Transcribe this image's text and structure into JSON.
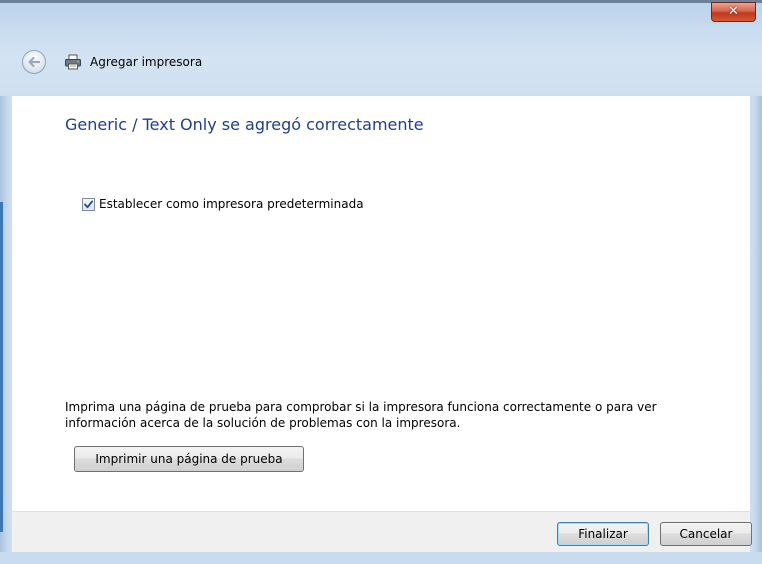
{
  "window": {
    "title": "Agregar impresora",
    "close_glyph": "✕"
  },
  "icons": {
    "back": "back-arrow-icon",
    "printer": "printer-icon",
    "check": "checkmark-icon"
  },
  "content": {
    "heading": "Generic / Text Only se agregó correctamente",
    "default_checkbox": {
      "label": "Establecer como impresora predeterminada",
      "checked": true
    },
    "info": "Imprima una página de prueba para comprobar si la impresora funciona correctamente o para ver información acerca de la solución de problemas con la impresora.",
    "test_page_button": "Imprimir una página de prueba"
  },
  "footer": {
    "finish_label": "Finalizar",
    "cancel_label": "Cancelar"
  },
  "colors": {
    "heading": "#1e3f8a",
    "frame": "#c8dbef",
    "close": "#c0391b",
    "default_button_border": "#3c7fb1"
  }
}
